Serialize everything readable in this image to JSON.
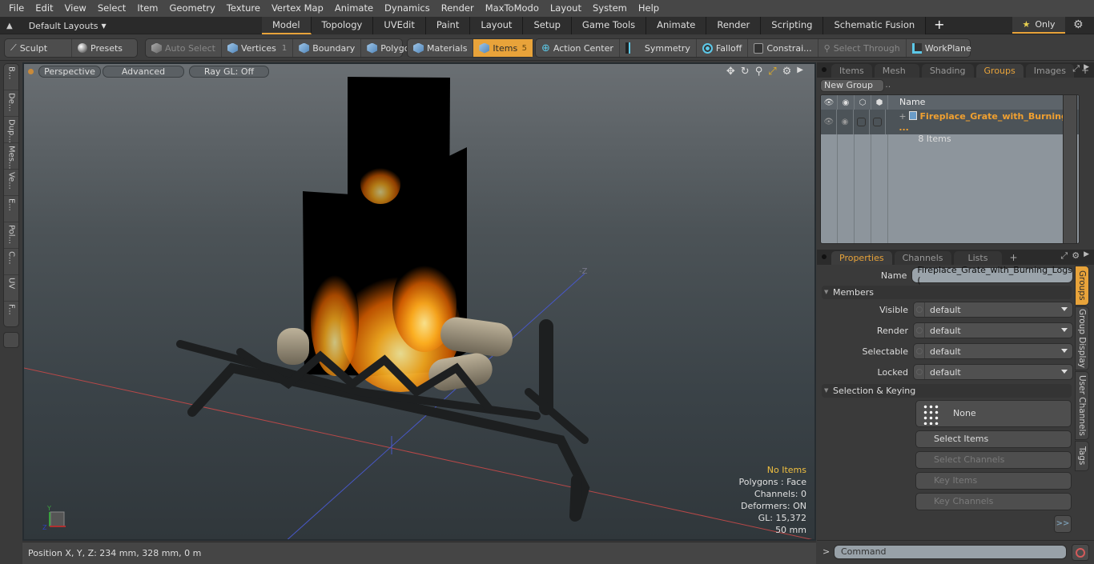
{
  "menu": [
    "File",
    "Edit",
    "View",
    "Select",
    "Item",
    "Geometry",
    "Texture",
    "Vertex Map",
    "Animate",
    "Dynamics",
    "Render",
    "MaxToModo",
    "Layout",
    "System",
    "Help"
  ],
  "layout_bar": {
    "layouts_label": "Default Layouts",
    "tabs": [
      "Model",
      "Topology",
      "UVEdit",
      "Paint",
      "Layout",
      "Setup",
      "Game Tools",
      "Animate",
      "Render",
      "Scripting",
      "Schematic Fusion"
    ],
    "active_tab": "Model",
    "add_label": "+",
    "only_label": "Only"
  },
  "toolbar": {
    "sculpt": "Sculpt",
    "presets": "Presets",
    "auto_select": "Auto Select",
    "vertices": "Vertices",
    "vertices_count": "1",
    "boundary": "Boundary",
    "polygons": "Polygons",
    "materials": "Materials",
    "items": "Items",
    "items_count": "5",
    "action_center": "Action Center",
    "symmetry": "Symmetry",
    "falloff": "Falloff",
    "constraints": "Constrai...",
    "select_through": "Select Through",
    "workplane": "WorkPlane"
  },
  "left_tabs": [
    "B...",
    "De...",
    "Dup...",
    "Mes...",
    "Ve...",
    "E...",
    "Pol...",
    "C...",
    "UV",
    "F..."
  ],
  "viewport": {
    "view_mode": "Perspective",
    "shading": "Advanced",
    "raygl": "Ray GL: Off",
    "info": {
      "selection": "No Items",
      "polygons": "Polygons : Face",
      "channels": "Channels: 0",
      "deformers": "Deformers: ON",
      "gl": "GL: 15,372",
      "scale": "50 mm"
    },
    "axis_label": "-Z"
  },
  "status": {
    "position": "Position X, Y, Z:   234 mm, 328 mm, 0 m"
  },
  "groups_panel": {
    "tabs": [
      "Items",
      "Mesh ...",
      "Shading",
      "Groups",
      "Images"
    ],
    "active_tab": "Groups",
    "new_group": "New Group",
    "name_header": "Name",
    "group": {
      "name": "Fireplace_Grate_with_Burning_ ...",
      "count": "8 Items"
    }
  },
  "properties_panel": {
    "tabs": [
      "Properties",
      "Channels",
      "Lists"
    ],
    "active_tab": "Properties",
    "name_label": "Name",
    "name_value": "Fireplace_Grate_with_Burning_Logs (",
    "members_section": "Members",
    "fields": [
      {
        "label": "Visible",
        "value": "default"
      },
      {
        "label": "Render",
        "value": "default"
      },
      {
        "label": "Selectable",
        "value": "default"
      },
      {
        "label": "Locked",
        "value": "default"
      }
    ],
    "selection_section": "Selection & Keying",
    "none_button": "None",
    "select_items": "Select Items",
    "select_channels": "Select Channels",
    "key_items": "Key Items",
    "key_channels": "Key Channels",
    "more": ">>",
    "side_tabs": [
      "Groups",
      "Group Display",
      "User Channels",
      "Tags"
    ]
  },
  "command": {
    "prompt": ">",
    "placeholder": "Command"
  }
}
